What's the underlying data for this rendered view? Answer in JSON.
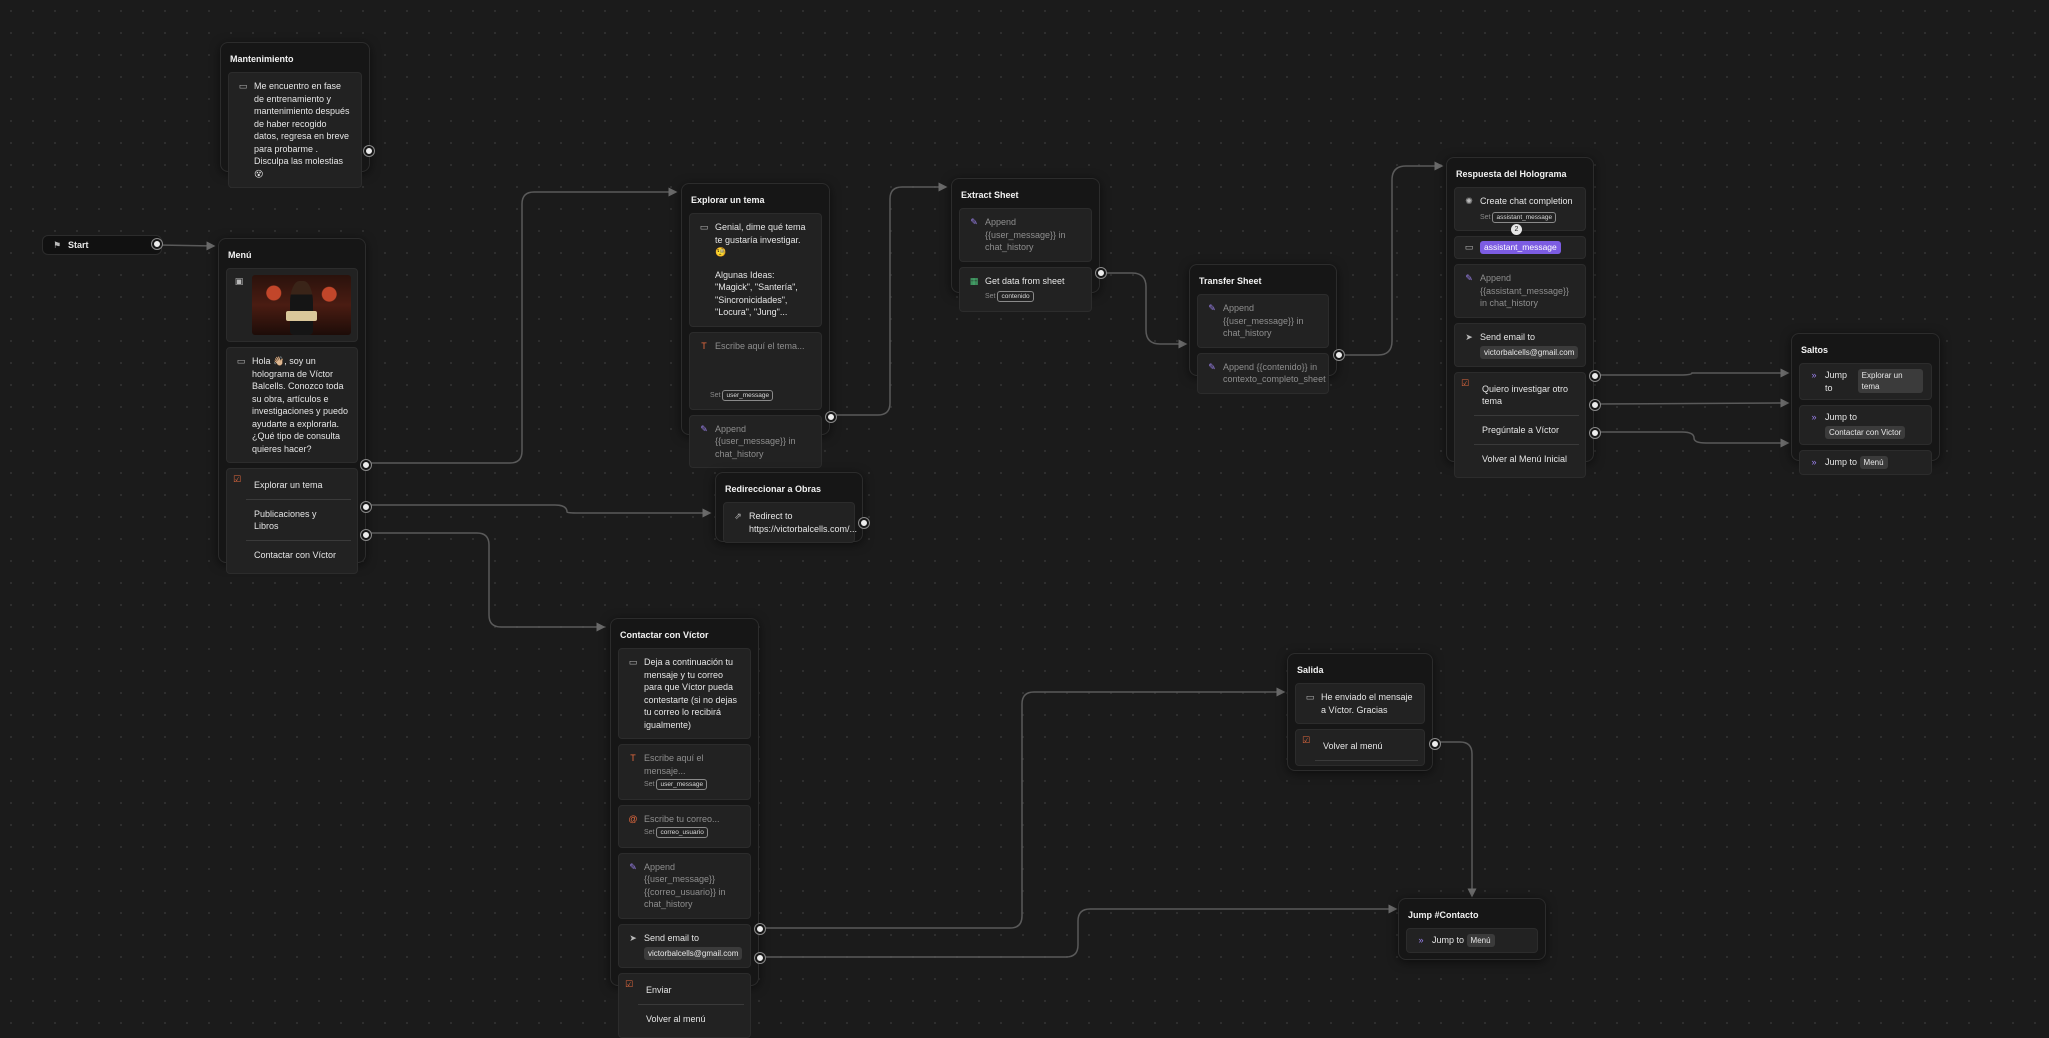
{
  "start": {
    "label": "Start"
  },
  "mantenimiento": {
    "title": "Mantenimiento",
    "message": "Me encuentro en fase de entrenamiento y mantenimiento después de haber recogido datos, regresa en breve para probarme . Disculpa las molestias 😵"
  },
  "menu": {
    "title": "Menú",
    "message": "Hola 👋🏼, soy un holograma de Víctor Balcells. Conozco toda su obra, artículos e investigaciones y puedo ayudarte a explorarla. ¿Qué tipo de consulta quieres hacer?",
    "choices": [
      "Explorar un tema",
      "Publicaciones y Libros",
      "Contactar con Víctor"
    ]
  },
  "explorar": {
    "title": "Explorar un tema",
    "message_line1": "Genial, dime qué tema te gustaría investigar. 🧐",
    "message_line2": "Algunas Ideas: \"Magick\", \"Santería\", \"Sincronicidades\", \"Locura\", \"Jung\"...",
    "input_placeholder": "Escribe aquí el tema...",
    "set_label": "Set",
    "set_var": "user_message",
    "append": "Append {{user_message}} in chat_history"
  },
  "extract": {
    "title": "Extract Sheet",
    "append": "Append {{user_message}} in chat_history",
    "get_data": "Get data from sheet",
    "set_label": "Set",
    "set_var": "contenido"
  },
  "transfer": {
    "title": "Transfer Sheet",
    "append1": "Append {{user_message}} in chat_history",
    "append2": "Append {{contenido}} in contexto_completo_sheet"
  },
  "respuesta": {
    "title": "Respuesta del Holograma",
    "create": "Create chat completion",
    "set_label": "Set",
    "set_var": "assistant_message",
    "badge": "2",
    "message_var": "assistant_message",
    "append": "Append {{assistant_message}} in chat_history",
    "send": "Send email to",
    "email": "victorbalcells@gmail.com",
    "choices": [
      "Quiero investigar otro tema",
      "Pregúntale a Víctor",
      "Volver al Menú Inicial"
    ]
  },
  "saltos": {
    "title": "Saltos",
    "jump_label": "Jump to",
    "targets": [
      "Explorar un tema",
      "Contactar con Victor",
      "Menú"
    ]
  },
  "redirect": {
    "title": "Redireccionar a Obras",
    "label": "Redirect to",
    "url": "https://victorbalcells.com/..."
  },
  "contactar": {
    "title": "Contactar con Víctor",
    "message": "Deja a continuación tu mensaje y tu correo para que Víctor pueda contestarte (si no dejas tu correo lo recibirá igualmente)",
    "input1_placeholder": "Escribe aquí el mensaje...",
    "set_label": "Set",
    "input1_var": "user_message",
    "input2_placeholder": "Escribe tu correo...",
    "input2_var": "correo_usuario",
    "append": "Append {{user_message}} {{correo_usuario}} in chat_history",
    "send": "Send email to",
    "email": "victorbalcells@gmail.com",
    "choices": [
      "Enviar",
      "Volver al menú"
    ]
  },
  "salida": {
    "title": "Salida",
    "message": "He enviado el mensaje a Víctor. Gracias",
    "choices": [
      "Volver al menú"
    ]
  },
  "jump_contacto": {
    "title": "Jump #Contacto",
    "jump_label": "Jump to",
    "target": "Menú"
  },
  "colors": {
    "background": "#1b1b1b",
    "node": "#161616",
    "block": "#222222",
    "accent_purple": "#7c5ce2",
    "accent_orange": "#e4693e",
    "edge": "#5e5e5e"
  }
}
